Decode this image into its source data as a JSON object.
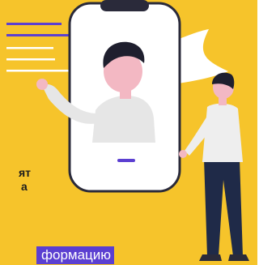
{
  "colors": {
    "background": "#f6c42b",
    "phone_frame": "#ffffff",
    "phone_outline": "#2a2a3a",
    "accent": "#5b3fd1",
    "skin": "#f3b8c3",
    "hair": "#1f1f2e",
    "shirt": "#e6e6e6",
    "pants": "#1f2a48"
  },
  "icons": {
    "message_lines": "text-lines-illustration",
    "bubble": "white-speech-bubble-illustration"
  },
  "caption": {
    "line1": "ят",
    "line2": "а",
    "highlight": "формацию"
  }
}
